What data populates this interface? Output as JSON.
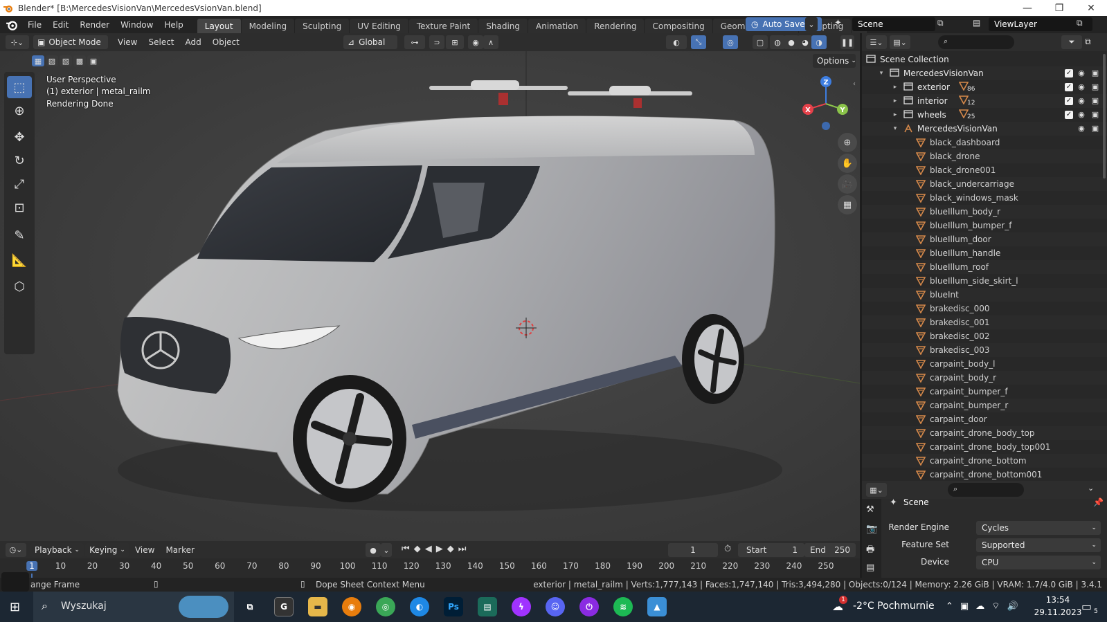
{
  "window": {
    "title": "Blender* [B:\\MercedesVisionVan\\MercedesVsionVan.blend]",
    "minimize": "—",
    "restore": "❐",
    "close": "✕"
  },
  "topbar": {
    "menus": [
      "File",
      "Edit",
      "Render",
      "Window",
      "Help"
    ],
    "workspaces": [
      "Layout",
      "Modeling",
      "Sculpting",
      "UV Editing",
      "Texture Paint",
      "Shading",
      "Animation",
      "Rendering",
      "Compositing",
      "Geometry Nodes",
      "Scripting"
    ],
    "active_workspace": "Layout",
    "add_tab": "+",
    "autosave_label": "Auto Save",
    "scene_name": "Scene",
    "view_layer": "ViewLayer"
  },
  "viewport_header": {
    "mode": "Object Mode",
    "menus": [
      "View",
      "Select",
      "Add",
      "Object"
    ],
    "transform_orientation": "Global",
    "options_label": "Options"
  },
  "viewport": {
    "info_lines": [
      "User Perspective",
      "(1) exterior | metal_railm",
      "Rendering Done"
    ],
    "gizmo_axes": {
      "x": "X",
      "y": "Y",
      "z": "Z"
    }
  },
  "outliner": {
    "root": "Scene Collection",
    "collection": "MercedesVisionVan",
    "children": [
      {
        "name": "exterior",
        "count": "86"
      },
      {
        "name": "interior",
        "count": "12"
      },
      {
        "name": "wheels",
        "count": "25"
      }
    ],
    "object": "MercedesVisionVan",
    "materials": [
      "black_dashboard",
      "black_drone",
      "black_drone001",
      "black_undercarriage",
      "black_windows_mask",
      "blueIllum_body_r",
      "blueIllum_bumper_f",
      "blueIllum_door",
      "blueIllum_handle",
      "blueIllum_roof",
      "blueIllum_side_skirt_l",
      "blueInt",
      "brakedisc_000",
      "brakedisc_001",
      "brakedisc_002",
      "brakedisc_003",
      "carpaint_body_l",
      "carpaint_body_r",
      "carpaint_bumper_f",
      "carpaint_bumper_r",
      "carpaint_door",
      "carpaint_drone_body_top",
      "carpaint_drone_body_top001",
      "carpaint_drone_bottom",
      "carpaint_drone_bottom001"
    ]
  },
  "properties": {
    "context": "Scene",
    "rows": [
      {
        "label": "Render Engine",
        "value": "Cycles"
      },
      {
        "label": "Feature Set",
        "value": "Supported"
      },
      {
        "label": "Device",
        "value": "CPU"
      }
    ]
  },
  "timeline": {
    "menus": [
      "Playback",
      "Keying",
      "View",
      "Marker"
    ],
    "current_frame": "1",
    "start_label": "Start",
    "start": "1",
    "end_label": "End",
    "end": "250",
    "ticks": [
      "1",
      "10",
      "20",
      "30",
      "40",
      "50",
      "60",
      "70",
      "80",
      "90",
      "100",
      "110",
      "120",
      "130",
      "140",
      "150",
      "160",
      "170",
      "180",
      "190",
      "200",
      "210",
      "220",
      "230",
      "240",
      "250"
    ]
  },
  "statusbar": {
    "left": "ange Frame",
    "middle": "Dope Sheet Context Menu",
    "stats": "exterior | metal_railm | Verts:1,777,143 | Faces:1,747,140 | Tris:3,494,280 | Objects:0/124 | Memory: 2.26 GiB | VRAM: 1.7/4.0 GiB | 3.4.1"
  },
  "taskbar": {
    "search_placeholder": "Wyszukaj",
    "weather": "-2°C  Pochmurnie",
    "weather_badge": "1",
    "time": "13:54",
    "date": "29.11.2023",
    "notification_count": "5",
    "apps": [
      "G",
      "Ps",
      "G"
    ]
  },
  "colors": {
    "accent": "#4772b3",
    "axis_x": "#e5414a",
    "axis_y": "#8bc34a",
    "axis_z": "#3d7de0",
    "material_icon": "#d6894a"
  }
}
